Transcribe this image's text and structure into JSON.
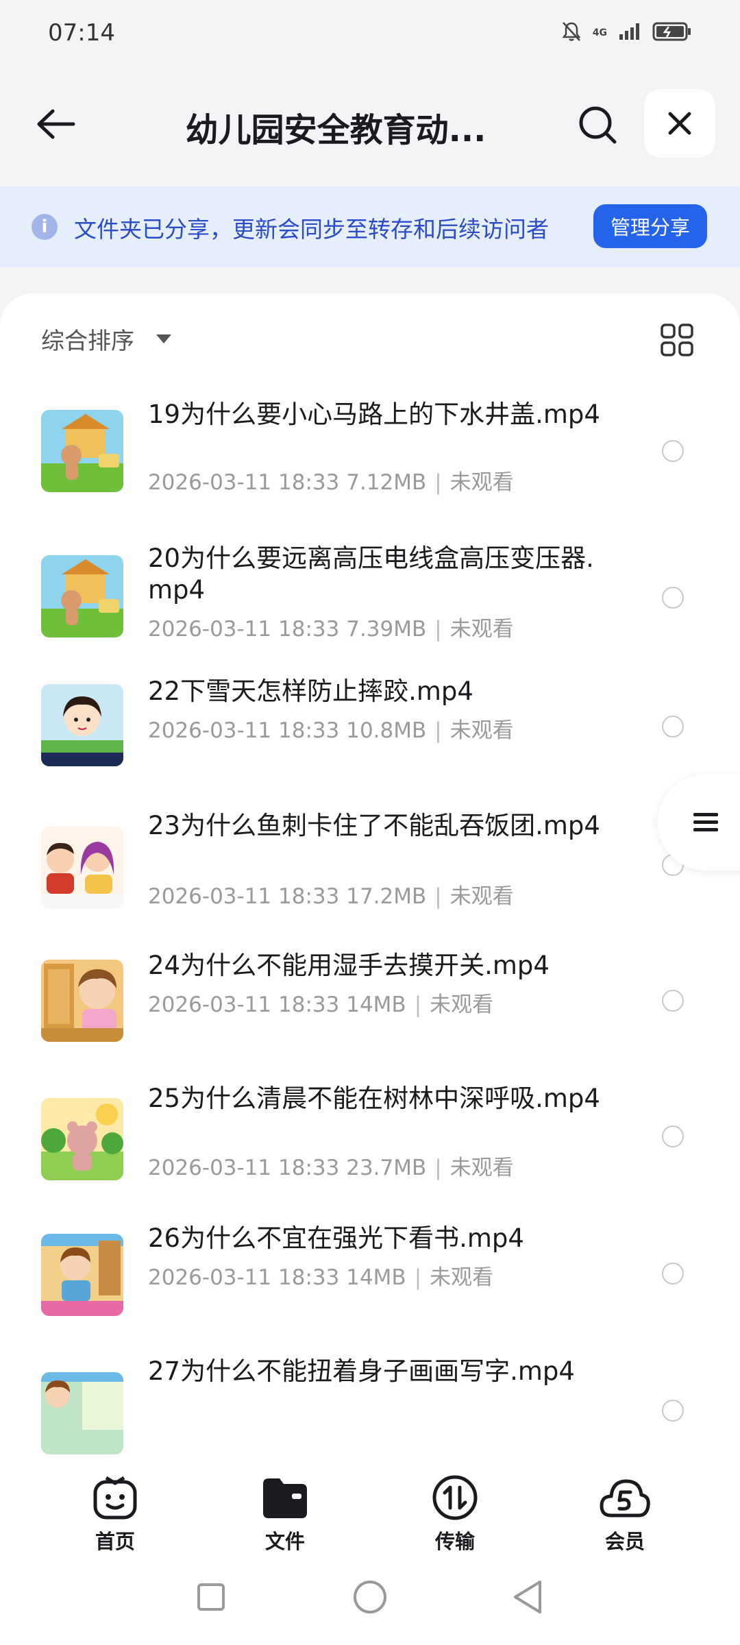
{
  "status_bar": {
    "time": "07:14",
    "network": "4G"
  },
  "header": {
    "title": "幼儿园安全教育动..."
  },
  "banner": {
    "text": "文件夹已分享，更新会同步至转存和后续访问者",
    "button": "管理分享",
    "info_glyph": "i"
  },
  "toolbar": {
    "sort_label": "综合排序"
  },
  "files": [
    {
      "name": "19为什么要小心马路上的下水井盖.mp4",
      "date": "2026-03-11 18:33",
      "size": "7.12MB",
      "status": "未观看"
    },
    {
      "name": "20为什么要远离高压电线盒高压变压器.mp4",
      "date": "2026-03-11 18:33",
      "size": "7.39MB",
      "status": "未观看"
    },
    {
      "name": "22下雪天怎样防止摔跤.mp4",
      "date": "2026-03-11 18:33",
      "size": "10.8MB",
      "status": "未观看"
    },
    {
      "name": "23为什么鱼刺卡住了不能乱吞饭团.mp4",
      "date": "2026-03-11 18:33",
      "size": "17.2MB",
      "status": "未观看"
    },
    {
      "name": "24为什么不能用湿手去摸开关.mp4",
      "date": "2026-03-11 18:33",
      "size": "14MB",
      "status": "未观看"
    },
    {
      "name": "25为什么清晨不能在树林中深呼吸.mp4",
      "date": "2026-03-11 18:33",
      "size": "23.7MB",
      "status": "未观看"
    },
    {
      "name": "26为什么不宜在强光下看书.mp4",
      "date": "2026-03-11 18:33",
      "size": "14MB",
      "status": "未观看"
    },
    {
      "name": "27为什么不能扭着身子画画写字.mp4",
      "date": "",
      "size": "",
      "status": ""
    }
  ],
  "tabs": [
    {
      "label": "首页",
      "icon": "smiley-home-icon"
    },
    {
      "label": "文件",
      "icon": "folder-icon"
    },
    {
      "label": "传输",
      "icon": "transfer-icon"
    },
    {
      "label": "会员",
      "icon": "cloud-vip-icon"
    }
  ],
  "colors": {
    "accent": "#2563eb",
    "banner_bg": "#e7eefb",
    "banner_text": "#2b4cc8"
  }
}
